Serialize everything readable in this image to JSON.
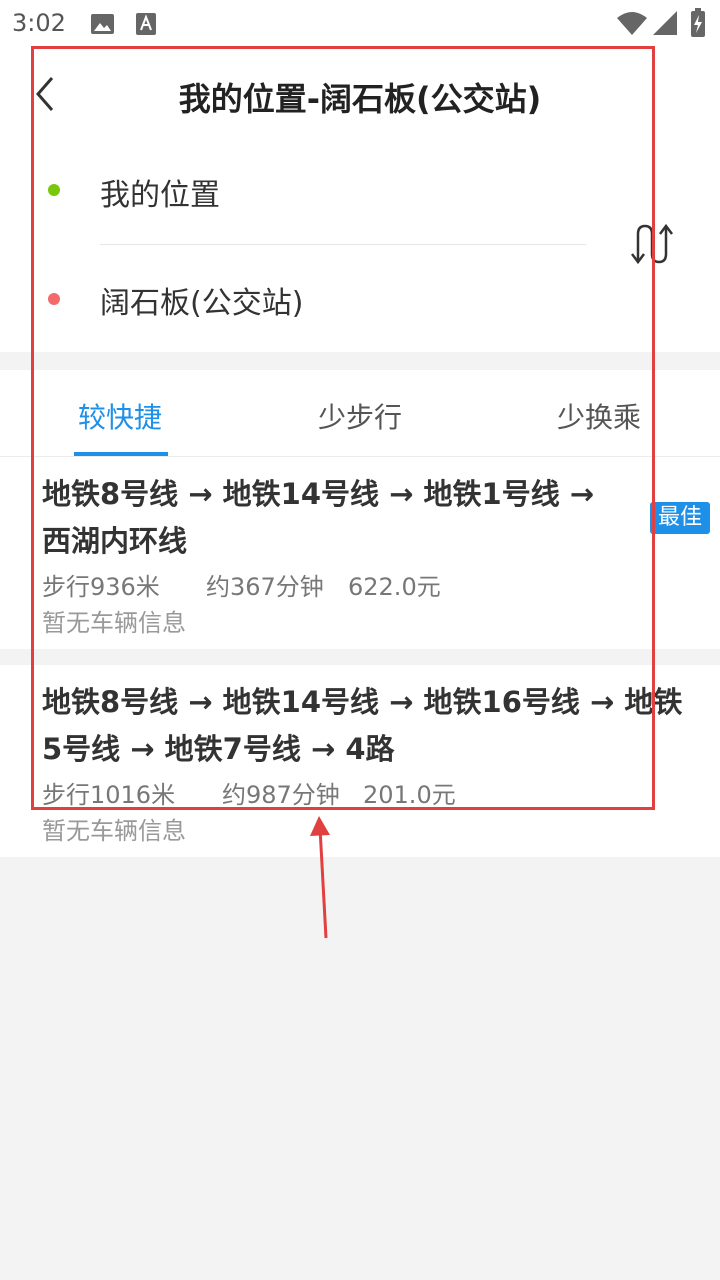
{
  "status_bar": {
    "time": "3:02",
    "icons": [
      "image-icon",
      "text-a-icon",
      "wifi-icon",
      "signal-icon",
      "battery-charging-icon"
    ]
  },
  "header": {
    "title": "我的位置-阔石板(公交站)",
    "back_icon": "chevron-left-icon"
  },
  "route": {
    "origin": "我的位置",
    "destination": "阔石板(公交站)",
    "origin_color": "#7ac70c",
    "destination_color": "#f26a6a",
    "swap_icon": "swap-icon"
  },
  "tabs": [
    {
      "label": "较快捷",
      "active": true
    },
    {
      "label": "少步行",
      "active": false
    },
    {
      "label": "少换乘",
      "active": false
    }
  ],
  "routes": [
    {
      "title": "地铁8号线 → 地铁14号线 → 地铁1号线 → 西湖内环线",
      "walk": "步行936米",
      "time": "约367分钟",
      "cost": "622.0元",
      "vehicle_info": "暂无车辆信息",
      "badge": "最佳"
    },
    {
      "title": "地铁8号线 → 地铁14号线 → 地铁16号线 → 地铁5号线 → 地铁7号线 → 4路",
      "walk": "步行1016米",
      "time": "约987分钟",
      "cost": "201.0元",
      "vehicle_info": "暂无车辆信息"
    }
  ],
  "colors": {
    "accent": "#1e90e8",
    "annotation": "#e04040"
  }
}
